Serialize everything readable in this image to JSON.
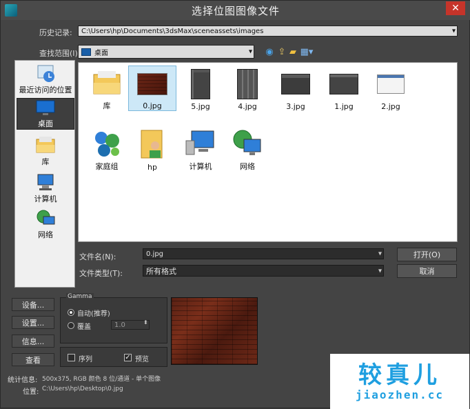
{
  "window": {
    "title": "选择位图图像文件",
    "close_glyph": "✕"
  },
  "history": {
    "label": "历史记录:",
    "value": "C:\\Users\\hp\\Documents\\3dsMax\\sceneassets\\images"
  },
  "lookin": {
    "label": "查找范围(I):",
    "value": "桌面"
  },
  "places": [
    {
      "label": "最近访问的位置",
      "icon": "recent-places-icon"
    },
    {
      "label": "桌面",
      "icon": "desktop-icon",
      "selected": true
    },
    {
      "label": "库",
      "icon": "library-icon"
    },
    {
      "label": "计算机",
      "icon": "computer-icon"
    },
    {
      "label": "网络",
      "icon": "network-icon"
    }
  ],
  "files": [
    {
      "label": "库",
      "icon": "library-folder-icon"
    },
    {
      "label": "0.jpg",
      "icon": "wood-thumbnail",
      "selected": true
    },
    {
      "label": "5.jpg",
      "icon": "screenshot-thumbnail"
    },
    {
      "label": "4.jpg",
      "icon": "screenshot-thumbnail"
    },
    {
      "label": "3.jpg",
      "icon": "screenshot-thumbnail"
    },
    {
      "label": "1.jpg",
      "icon": "screenshot-thumbnail"
    },
    {
      "label": "2.jpg",
      "icon": "screenshot-thumbnail"
    },
    {
      "label": "家庭组",
      "icon": "homegroup-icon"
    },
    {
      "label": "hp",
      "icon": "user-folder-icon"
    },
    {
      "label": "计算机",
      "icon": "computer-icon"
    },
    {
      "label": "网络",
      "icon": "network-icon"
    }
  ],
  "filename": {
    "label": "文件名(N):",
    "value": "0.jpg"
  },
  "filetype": {
    "label": "文件类型(T):",
    "value": "所有格式"
  },
  "buttons": {
    "open": "打开(O)",
    "cancel": "取消",
    "setup": "设备...",
    "settings": "设置...",
    "info": "信息...",
    "view": "查看"
  },
  "gamma": {
    "legend": "Gamma",
    "auto": "自动(推荐)",
    "override": "覆盖",
    "override_value": "1.0"
  },
  "options": {
    "sequence": "序列",
    "preview": "预览",
    "preview_checked": true,
    "sequence_checked": false
  },
  "stats": {
    "label": "统计信息:",
    "value": "500x375, RGB 颜色 8 位/通道 - 单个图像"
  },
  "location": {
    "label": "位置:",
    "value": "C:\\Users\\hp\\Desktop\\0.jpg"
  },
  "watermark": {
    "main": "较真儿",
    "sub": "jiaozhen.cc"
  },
  "colors": {
    "accent": "#1f9fe0",
    "close": "#c6342a",
    "selection": "#cde8f7"
  }
}
